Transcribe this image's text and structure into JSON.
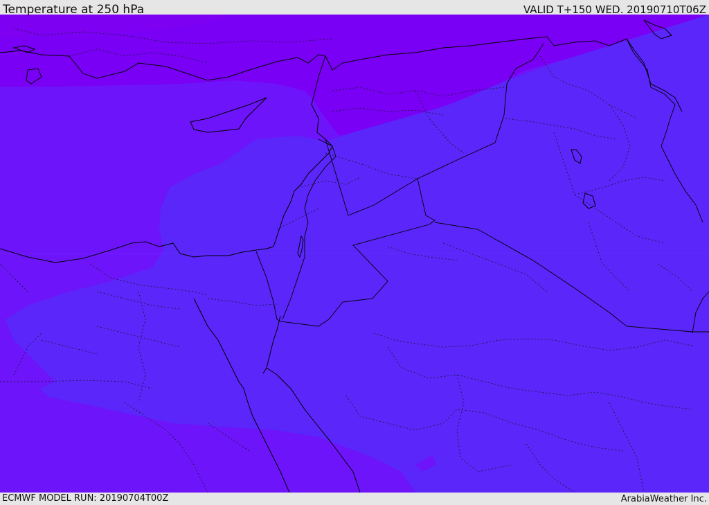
{
  "header": {
    "title": "Temperature at 250 hPa",
    "valid": "VALID T+150 WED. 20190710T06Z"
  },
  "footer": {
    "model_run": "ECMWF MODEL RUN: 20190704T00Z",
    "credit": "ArabiaWeather Inc."
  },
  "map": {
    "field": "temperature",
    "level": "250 hPa",
    "colors": {
      "cold_band": "#7a00f5",
      "mid_band": "#6d14fa",
      "warm_band": "#5a26fa",
      "coastline": "#000000",
      "border": "#1a1a3a"
    }
  }
}
